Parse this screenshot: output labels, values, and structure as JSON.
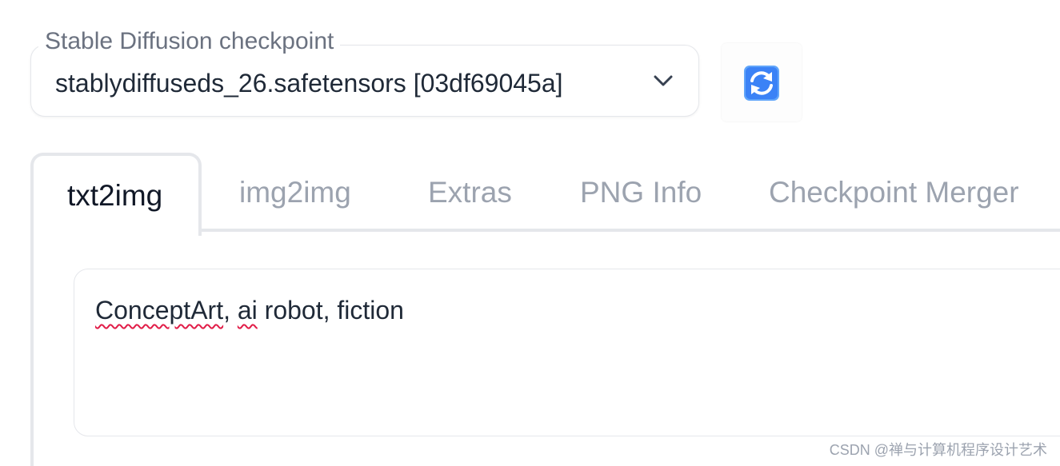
{
  "checkpoint": {
    "label": "Stable Diffusion checkpoint",
    "selected_value": "stablydiffuseds_26.safetensors [03df69045a]",
    "dropdown_icon": "chevron-down-icon",
    "refresh_icon": "refresh-arrows-icon"
  },
  "tabs": [
    {
      "label": "txt2img",
      "active": true
    },
    {
      "label": "img2img",
      "active": false
    },
    {
      "label": "Extras",
      "active": false
    },
    {
      "label": "PNG Info",
      "active": false
    },
    {
      "label": "Checkpoint Merger",
      "active": false
    }
  ],
  "prompt": {
    "word_1": "ConceptArt",
    "sep_1": ", ",
    "word_2": "ai",
    "rest": " robot, fiction"
  },
  "watermark": "CSDN @禅与计算机程序设计艺术",
  "colors": {
    "refresh_icon_blue": "#3b82f6",
    "spellcheck_underline": "#e11d48",
    "border": "#e5e7eb"
  }
}
